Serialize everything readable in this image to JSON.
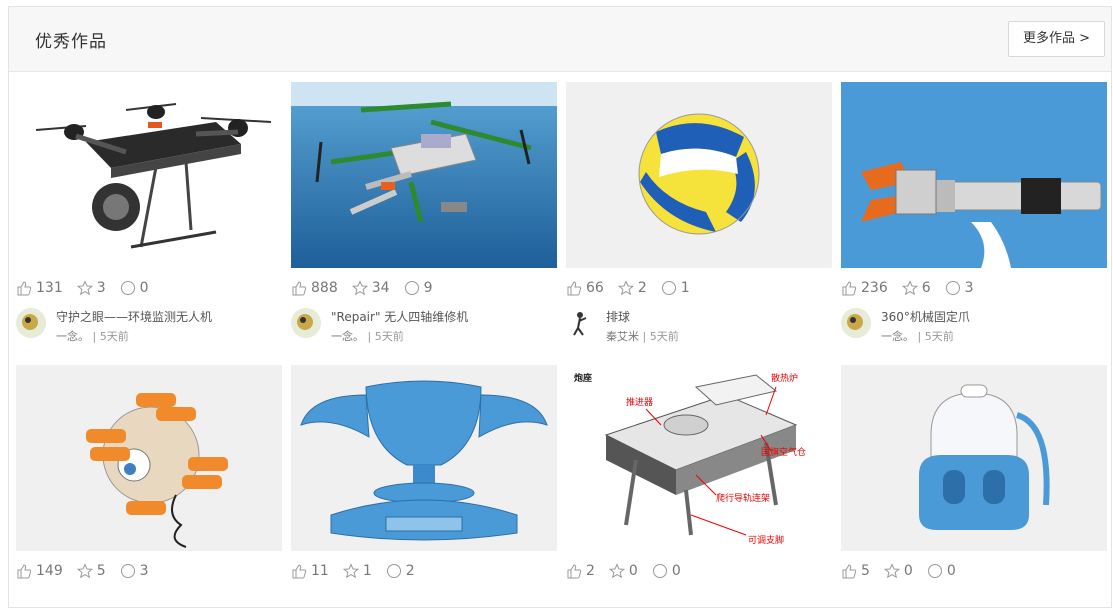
{
  "section": {
    "title": "优秀作品",
    "more_label": "更多作品 >"
  },
  "colors": {
    "header_bg": "#f7f7f7",
    "blue_bg": "#4a9ad8",
    "sea": "#2a78b8"
  },
  "cards": [
    {
      "likes": "131",
      "stars": "3",
      "comments": "0",
      "title": "守护之眼——环境监测无人机",
      "author": "一念。",
      "time": "5天前"
    },
    {
      "likes": "888",
      "stars": "34",
      "comments": "9",
      "title": "\"Repair\" 无人四轴维修机",
      "author": "一念。",
      "time": "5天前"
    },
    {
      "likes": "66",
      "stars": "2",
      "comments": "1",
      "title": "排球",
      "author": "秦艾米",
      "time": "5天前"
    },
    {
      "likes": "236",
      "stars": "6",
      "comments": "3",
      "title": "360°机械固定爪",
      "author": "一念。",
      "time": "5天前"
    },
    {
      "likes": "149",
      "stars": "5",
      "comments": "3"
    },
    {
      "likes": "11",
      "stars": "1",
      "comments": "2"
    },
    {
      "likes": "2",
      "stars": "0",
      "comments": "0",
      "labels": [
        "炮座",
        "推进器",
        "散热炉",
        "国旗空气仓",
        "爬行导轨连架",
        "可调支脚"
      ]
    },
    {
      "likes": "5",
      "stars": "0",
      "comments": "0"
    }
  ],
  "byline_separator": " | "
}
